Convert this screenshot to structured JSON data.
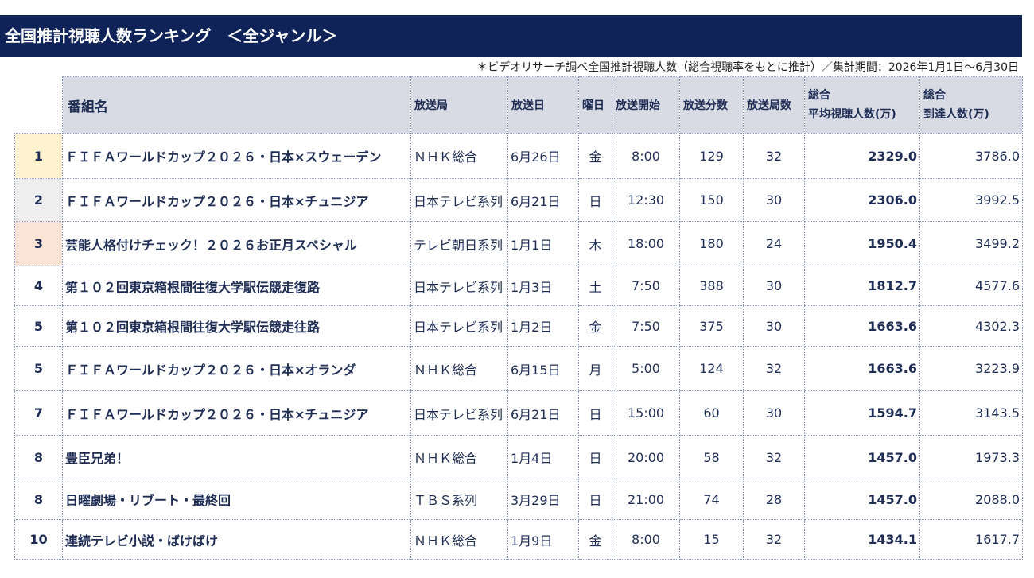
{
  "title": "全国推計視聴人数ランキング　＜全ジャンル＞",
  "note": "＊ビデオリサーチ調べ全国推計視聴人数（総合視聴率をもとに推計）／集計期間：2026年1月1日～6月30日",
  "headers": {
    "program": "番組名",
    "station": "放送局",
    "date": "放送日",
    "weekday": "曜日",
    "start": "放送開始",
    "minutes": "放送分数",
    "stations_count": "放送局数",
    "avg_line1": "総合",
    "avg_line2": "平均視聴人数(万)",
    "reach_line1": "総合",
    "reach_line2": "到達人数(万)"
  },
  "rows": [
    {
      "rank": "1",
      "program": "ＦＩＦＡワールドカップ２０２６・日本×スウェーデン",
      "station": "ＮＨＫ総合",
      "date": "6月26日",
      "weekday": "金",
      "start": "8:00",
      "minutes": "129",
      "stations": "32",
      "avg": "2329.0",
      "reach": "3786.0"
    },
    {
      "rank": "2",
      "program": "ＦＩＦＡワールドカップ２０２６・日本×チュニジア",
      "station": "日本テレビ系列",
      "date": "6月21日",
      "weekday": "日",
      "start": "12:30",
      "minutes": "150",
      "stations": "30",
      "avg": "2306.0",
      "reach": "3992.5"
    },
    {
      "rank": "3",
      "program": "芸能人格付けチェック！２０２６お正月スペシャル",
      "station": "テレビ朝日系列",
      "date": "1月1日",
      "weekday": "木",
      "start": "18:00",
      "minutes": "180",
      "stations": "24",
      "avg": "1950.4",
      "reach": "3499.2"
    },
    {
      "rank": "4",
      "program": "第１０２回東京箱根間往復大学駅伝競走復路",
      "station": "日本テレビ系列",
      "date": "1月3日",
      "weekday": "土",
      "start": "7:50",
      "minutes": "388",
      "stations": "30",
      "avg": "1812.7",
      "reach": "4577.6"
    },
    {
      "rank": "5",
      "program": "第１０２回東京箱根間往復大学駅伝競走往路",
      "station": "日本テレビ系列",
      "date": "1月2日",
      "weekday": "金",
      "start": "7:50",
      "minutes": "375",
      "stations": "30",
      "avg": "1663.6",
      "reach": "4302.3"
    },
    {
      "rank": "5",
      "program": "ＦＩＦＡワールドカップ２０２６・日本×オランダ",
      "station": "ＮＨＫ総合",
      "date": "6月15日",
      "weekday": "月",
      "start": "5:00",
      "minutes": "124",
      "stations": "32",
      "avg": "1663.6",
      "reach": "3223.9"
    },
    {
      "rank": "7",
      "program": "ＦＩＦＡワールドカップ２０２６・日本×チュニジア",
      "station": "日本テレビ系列",
      "date": "6月21日",
      "weekday": "日",
      "start": "15:00",
      "minutes": "60",
      "stations": "30",
      "avg": "1594.7",
      "reach": "3143.5"
    },
    {
      "rank": "8",
      "program": "豊臣兄弟！",
      "station": "ＮＨＫ総合",
      "date": "1月4日",
      "weekday": "日",
      "start": "20:00",
      "minutes": "58",
      "stations": "32",
      "avg": "1457.0",
      "reach": "1973.3"
    },
    {
      "rank": "8",
      "program": "日曜劇場・リブート・最終回",
      "station": "ＴＢＳ系列",
      "date": "3月29日",
      "weekday": "日",
      "start": "21:00",
      "minutes": "74",
      "stations": "28",
      "avg": "1457.0",
      "reach": "2088.0"
    },
    {
      "rank": "10",
      "program": "連続テレビ小説・ばけばけ",
      "station": "ＮＨＫ総合",
      "date": "1月9日",
      "weekday": "金",
      "start": "8:00",
      "minutes": "15",
      "stations": "32",
      "avg": "1434.1",
      "reach": "1617.7"
    }
  ]
}
